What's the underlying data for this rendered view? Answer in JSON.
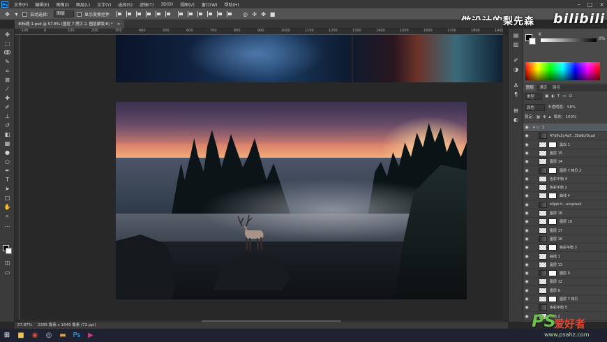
{
  "menubar": {
    "items": [
      "文件(F)",
      "编辑(E)",
      "图像(I)",
      "图层(L)",
      "文字(Y)",
      "选择(S)",
      "滤镜(T)",
      "3D(D)",
      "视图(V)",
      "窗口(W)",
      "帮助(H)"
    ]
  },
  "options": {
    "auto_select_label": "自动选择：",
    "auto_select_value": "图层",
    "show_transform_label": "显示变换控件"
  },
  "watermark": {
    "channel_text": "做设计的梨先森",
    "bili_text": "bilibili"
  },
  "document": {
    "tab_title": "未标题-1.psd @ 57.8% (图层 7 拷贝 2, 图层蒙版/8) *",
    "close_icon": "×"
  },
  "ruler": {
    "top_labels": [
      "-100",
      "0",
      "100",
      "200",
      "300",
      "400",
      "500",
      "600",
      "700",
      "800",
      "900",
      "1000",
      "1100",
      "1200",
      "1300",
      "1400",
      "1500",
      "1600",
      "1700",
      "1800",
      "1900"
    ]
  },
  "status": {
    "zoom": "57.87%",
    "doc_info": "2289 像素 x 1649 像素 (72 ppi)"
  },
  "color_panel": {
    "channel_letter": "K",
    "value": "0",
    "percent": "%"
  },
  "layers_panel": {
    "tabs": [
      "图层",
      "通道",
      "路径"
    ],
    "filter_label": "类型",
    "blend_mode": "颜色",
    "opacity_label": "不透明度:",
    "opacity_value": "58%",
    "lock_label": "锁定:",
    "fill_label": "填充:",
    "fill_value": "100%",
    "layers": [
      {
        "name": "1",
        "group": true
      },
      {
        "name": "47d9c5c4a7...35d6cf0cad",
        "group": false
      },
      {
        "name": "黑白 1",
        "group": false
      },
      {
        "name": "图层 15",
        "group": false
      },
      {
        "name": "图层 14",
        "group": false
      },
      {
        "name": "图层 7 拷贝 2",
        "group": false
      },
      {
        "name": "色彩平衡 4",
        "group": false
      },
      {
        "name": "色彩平衡 2",
        "group": false
      },
      {
        "name": "曲线 4",
        "group": false
      },
      {
        "name": "elijah-h...unsplash",
        "group": false
      },
      {
        "name": "图层 18",
        "group": false
      },
      {
        "name": "图层 19",
        "group": false
      },
      {
        "name": "图层 17",
        "group": false
      },
      {
        "name": "图层 16",
        "group": false
      },
      {
        "name": "色彩平衡 3",
        "group": false
      },
      {
        "name": "曲线 1",
        "group": false
      },
      {
        "name": "图层 13",
        "group": false
      },
      {
        "name": "图层 9",
        "group": false
      },
      {
        "name": "图层 12",
        "group": false
      },
      {
        "name": "图层 8",
        "group": false
      },
      {
        "name": "图层 7 拷贝",
        "group": false
      },
      {
        "name": "色彩平衡 5",
        "group": false
      },
      {
        "name": "曲线 2",
        "group": false
      }
    ]
  },
  "ps_watermark": {
    "logo": "PS",
    "site_cn": "爱好者",
    "url": "www.psahz.com"
  }
}
